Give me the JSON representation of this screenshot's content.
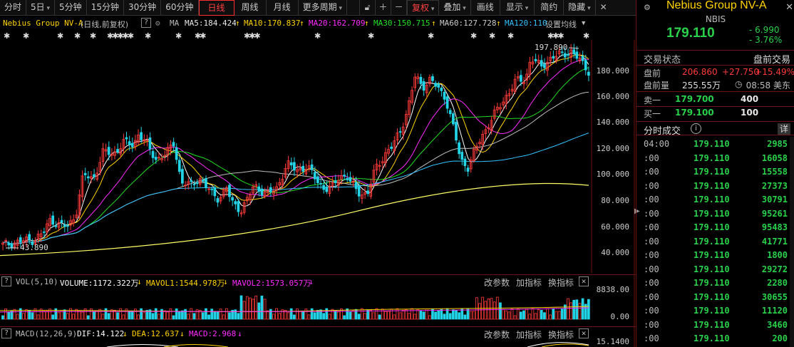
{
  "toolbar": {
    "periods": [
      {
        "label": "分时",
        "active": false,
        "dropdown": false
      },
      {
        "label": "5日",
        "active": false,
        "dropdown": true
      },
      {
        "label": "5分钟",
        "active": false,
        "dropdown": false
      },
      {
        "label": "15分钟",
        "active": false,
        "dropdown": false
      },
      {
        "label": "30分钟",
        "active": false,
        "dropdown": false
      },
      {
        "label": "60分钟",
        "active": false,
        "dropdown": false
      },
      {
        "label": "日线",
        "active": true,
        "dropdown": false
      },
      {
        "label": "周线",
        "active": false,
        "dropdown": false
      },
      {
        "label": "月线",
        "active": false,
        "dropdown": false
      },
      {
        "label": "更多周期",
        "active": false,
        "dropdown": true
      }
    ],
    "tools": [
      {
        "label": "复权",
        "dropdown": true,
        "active": true
      },
      {
        "label": "叠加",
        "dropdown": true,
        "active": false
      },
      {
        "label": "画线",
        "dropdown": false,
        "active": false
      },
      {
        "label": "显示",
        "dropdown": true,
        "active": false
      },
      {
        "label": "简约",
        "dropdown": false,
        "active": false
      },
      {
        "label": "隐藏",
        "dropdown": true,
        "active": false
      }
    ]
  },
  "chart_header": {
    "stock_label": "Nebius Group NV-A",
    "mode": "(日线,前复权)",
    "ma_label": "MA",
    "ma": [
      {
        "text": "MA5:184.424",
        "color": "#ffffff"
      },
      {
        "text": "MA10:170.837",
        "color": "#ffd200"
      },
      {
        "text": "MA20:162.709",
        "color": "#ff2bff"
      },
      {
        "text": "MA30:150.715",
        "color": "#22e022"
      },
      {
        "text": "MA60:127.728",
        "color": "#cccccc"
      },
      {
        "text": "MA120:110",
        "color": "#33c3ff"
      }
    ],
    "settings_label": "设置均线"
  },
  "price_axis": [
    "180.000",
    "160.000",
    "140.000",
    "120.000",
    "100.000",
    "80.000",
    "60.000",
    "40.000"
  ],
  "annotations": {
    "high": "197.890",
    "low": "43.890"
  },
  "volume_header": {
    "title": "VOL(5,10)",
    "items": [
      {
        "text": "VOLUME:1172.322万",
        "color": "#ffffff"
      },
      {
        "text": "MAVOL1:1544.978万",
        "color": "#ffd200"
      },
      {
        "text": "MAVOL2:1573.057万",
        "color": "#ff2bff"
      }
    ],
    "actions": [
      "改参数",
      "加指标",
      "换指标"
    ],
    "axis": [
      "8838.00",
      "0.00"
    ]
  },
  "macd_header": {
    "title": "MACD(12,26,9)",
    "items": [
      {
        "text": "DIF:14.122",
        "color": "#ffffff"
      },
      {
        "text": "DEA:12.637",
        "color": "#ffd200"
      },
      {
        "text": "MACD:2.968",
        "color": "#ff2bff"
      }
    ],
    "actions": [
      "改参数",
      "加指标",
      "换指标"
    ],
    "axis": [
      "15.1400"
    ]
  },
  "quote": {
    "name": "Nebius Group NV-A",
    "code": "NBIS",
    "price": "179.110",
    "change": "- 6.990",
    "change_pct": "- 3.76%",
    "status_label": "交易状态",
    "status_value": "盘前交易",
    "premarket_label": "盘前",
    "premarket_price": "206.860",
    "premarket_change": "+27.750",
    "premarket_pct": "+15.49%",
    "premarket_vol_label": "盘前量",
    "premarket_vol": "255.55万",
    "clock": "08:58 美东",
    "ask_label": "卖一",
    "ask_price": "179.700",
    "ask_vol": "400",
    "bid_label": "买一",
    "bid_price": "179.100",
    "bid_vol": "100"
  },
  "ticks": {
    "title": "分时成交",
    "detail_label": "详",
    "rows": [
      {
        "time": "04:00",
        "price": "179.110",
        "vol": "2985"
      },
      {
        "time": ":00",
        "price": "179.110",
        "vol": "16058"
      },
      {
        "time": ":00",
        "price": "179.110",
        "vol": "15558"
      },
      {
        "time": ":00",
        "price": "179.110",
        "vol": "27373"
      },
      {
        "time": ":00",
        "price": "179.110",
        "vol": "30791"
      },
      {
        "time": ":00",
        "price": "179.110",
        "vol": "95261"
      },
      {
        "time": ":00",
        "price": "179.110",
        "vol": "95483"
      },
      {
        "time": ":00",
        "price": "179.110",
        "vol": "41771"
      },
      {
        "time": ":00",
        "price": "179.110",
        "vol": "1800"
      },
      {
        "time": ":00",
        "price": "179.110",
        "vol": "29272"
      },
      {
        "time": ":00",
        "price": "179.110",
        "vol": "2280"
      },
      {
        "time": ":00",
        "price": "179.110",
        "vol": "30655"
      },
      {
        "time": ":00",
        "price": "179.110",
        "vol": "11120"
      },
      {
        "time": ":00",
        "price": "179.110",
        "vol": "3460"
      },
      {
        "time": ":00",
        "price": "179.110",
        "vol": "200"
      }
    ]
  }
}
